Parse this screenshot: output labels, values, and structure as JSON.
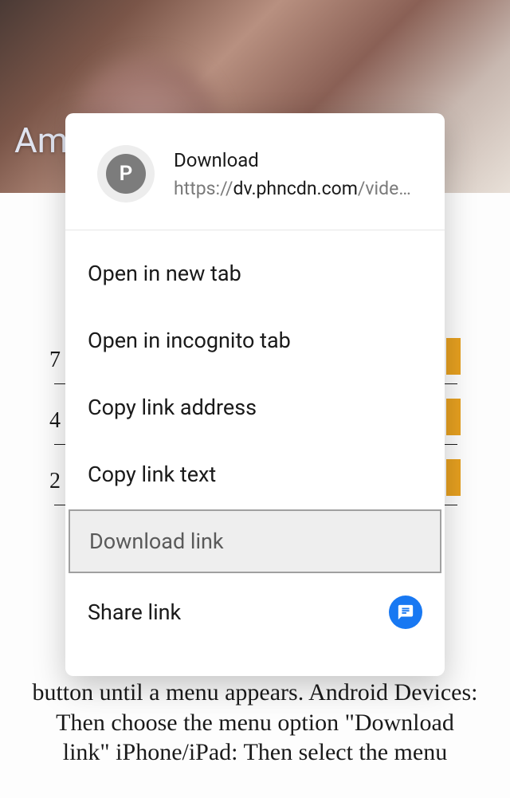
{
  "background": {
    "video_title_partial": "Am",
    "list_numbers": [
      "7",
      "4",
      "2"
    ],
    "instruction_text": "button until a menu appears. Android Devices: Then choose the menu option \"Download link\" iPhone/iPad: Then select the menu"
  },
  "context_menu": {
    "avatar_letter": "P",
    "title": "Download",
    "url_prefix": "https://",
    "url_host": "dv.phncdn.com",
    "url_path": "/vide…",
    "items": [
      {
        "label": "Open in new tab",
        "selected": false,
        "share": false
      },
      {
        "label": "Open in incognito tab",
        "selected": false,
        "share": false
      },
      {
        "label": "Copy link address",
        "selected": false,
        "share": false
      },
      {
        "label": "Copy link text",
        "selected": false,
        "share": false
      },
      {
        "label": "Download link",
        "selected": true,
        "share": false
      },
      {
        "label": "Share link",
        "selected": false,
        "share": true
      }
    ]
  }
}
